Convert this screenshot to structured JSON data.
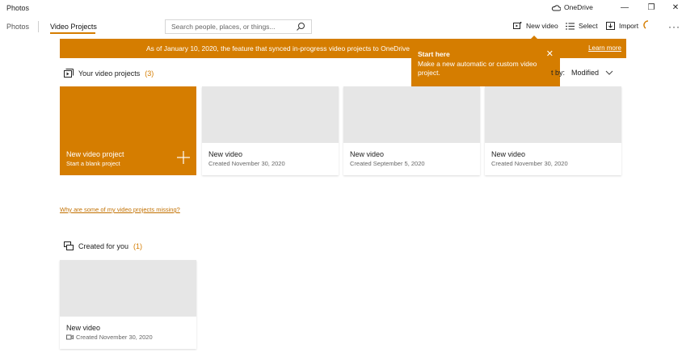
{
  "app": {
    "title": "Photos"
  },
  "window": {
    "onedrive_label": "OneDrive",
    "minimize": "—",
    "restore": "❐",
    "close": "✕"
  },
  "nav": {
    "tabs": [
      {
        "label": "Photos"
      },
      {
        "label": "Video Projects"
      }
    ],
    "active_tab": "Video Projects"
  },
  "search": {
    "placeholder": "Search people, places, or things..."
  },
  "toolbar": {
    "new_video": "New video",
    "select": "Select",
    "import": "Import",
    "more": "···"
  },
  "banner": {
    "text": "As of January 10, 2020, the feature that synced in-progress video projects to OneDrive",
    "link": "Learn more"
  },
  "tip": {
    "title": "Start here",
    "body": "Make a new automatic or custom video project.",
    "close": "✕"
  },
  "projects_section": {
    "title": "Your video projects",
    "count": "(3)"
  },
  "sort": {
    "label": "t by:",
    "value": "Modified"
  },
  "new_project_card": {
    "title": "New video project",
    "subtitle": "Start a blank project"
  },
  "projects": [
    {
      "title": "New video",
      "date": "Created November 30, 2020"
    },
    {
      "title": "New video",
      "date": "Created September 5, 2020"
    },
    {
      "title": "New video",
      "date": "Created November 30, 2020"
    }
  ],
  "missing_link": "Why are some of my video projects missing?",
  "created_section": {
    "title": "Created for you",
    "count": "(1)"
  },
  "created_items": [
    {
      "title": "New video",
      "date": "Created November 30, 2020"
    }
  ],
  "colors": {
    "accent": "#d57d00",
    "thumb": "#e6e6e6"
  }
}
